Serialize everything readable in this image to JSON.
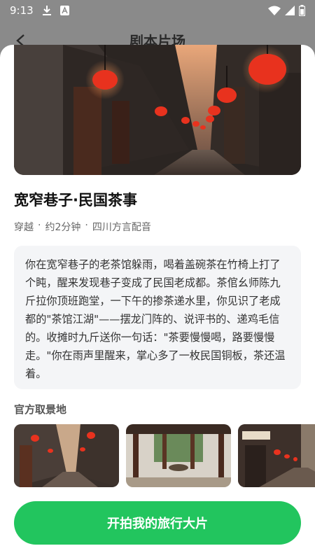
{
  "status_bar": {
    "time": "9:13",
    "icons": [
      "download-icon",
      "a-badge-icon",
      "wifi-icon",
      "signal-icon",
      "battery-icon"
    ]
  },
  "background_page": {
    "title": "剧本片场",
    "back_icon": "back-arrow-icon"
  },
  "sheet": {
    "title": "宽窄巷子·民国茶事",
    "meta": [
      "穿越",
      "·",
      "约2分钟",
      "·",
      "四川方言配音"
    ],
    "story": "你在宽窄巷子的老茶馆躲雨，喝着盖碗茶在竹椅上打了个盹，醒来发现巷子变成了民国老成都。茶倌幺师陈九斤拉你顶班跑堂，一下午的掺茶递水里，你见识了老成都的\"茶馆江湖\"——摆龙门阵的、说评书的、递鸡毛信的。收摊时九斤送你一句话：\"茶要慢慢喝，路要慢慢走。\"你在雨声里醒来，掌心多了一枚民国铜板，茶还温着。",
    "section_label": "官方取景地",
    "thumbnails": [
      "lantern-alley-photo",
      "courtyard-photo",
      "teahouse-street-photo"
    ],
    "cta_label": "开拍我的旅行大片"
  },
  "colors": {
    "accent": "#22c55e",
    "lantern": "#e8321e",
    "scrim": "#8a8a8a"
  }
}
